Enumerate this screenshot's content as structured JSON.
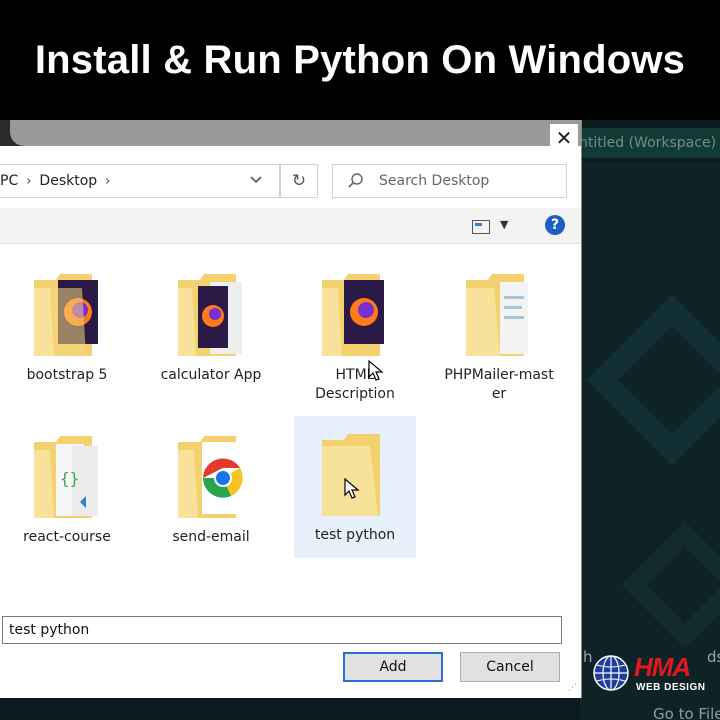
{
  "banner": {
    "title": "Install & Run Python On Windows"
  },
  "background_app": {
    "title": "ntitled (Workspace)",
    "text_partial": "h",
    "text_suffix": "ds",
    "footer_text": "Go to File"
  },
  "dialog": {
    "close_symbol": "✕",
    "breadcrumb": [
      "PC",
      "Desktop"
    ],
    "search_placeholder": "Search Desktop",
    "help_symbol": "?",
    "files": [
      {
        "name": "bootstrap 5",
        "icon": "folder-firefox-icon"
      },
      {
        "name": "calculator App",
        "icon": "folder-firefox-icon"
      },
      {
        "name": "HTML Description",
        "icon": "folder-firefox-icon"
      },
      {
        "name": "PHPMailer-master",
        "icon": "folder-documents-icon"
      },
      {
        "name": "react-course",
        "icon": "folder-code-icon"
      },
      {
        "name": "send-email",
        "icon": "folder-chrome-icon"
      },
      {
        "name": "test python",
        "icon": "folder-empty-icon",
        "selected": true
      }
    ],
    "filename_value": "test python",
    "add_label": "Add",
    "cancel_label": "Cancel"
  },
  "logo": {
    "mark": "HMA",
    "tagline": "WEB DESIGN"
  },
  "colors": {
    "accent": "#1f5fbf",
    "folder": "#f5d77e",
    "selection": "#e6f1fb",
    "brand_red": "#e0191f"
  }
}
